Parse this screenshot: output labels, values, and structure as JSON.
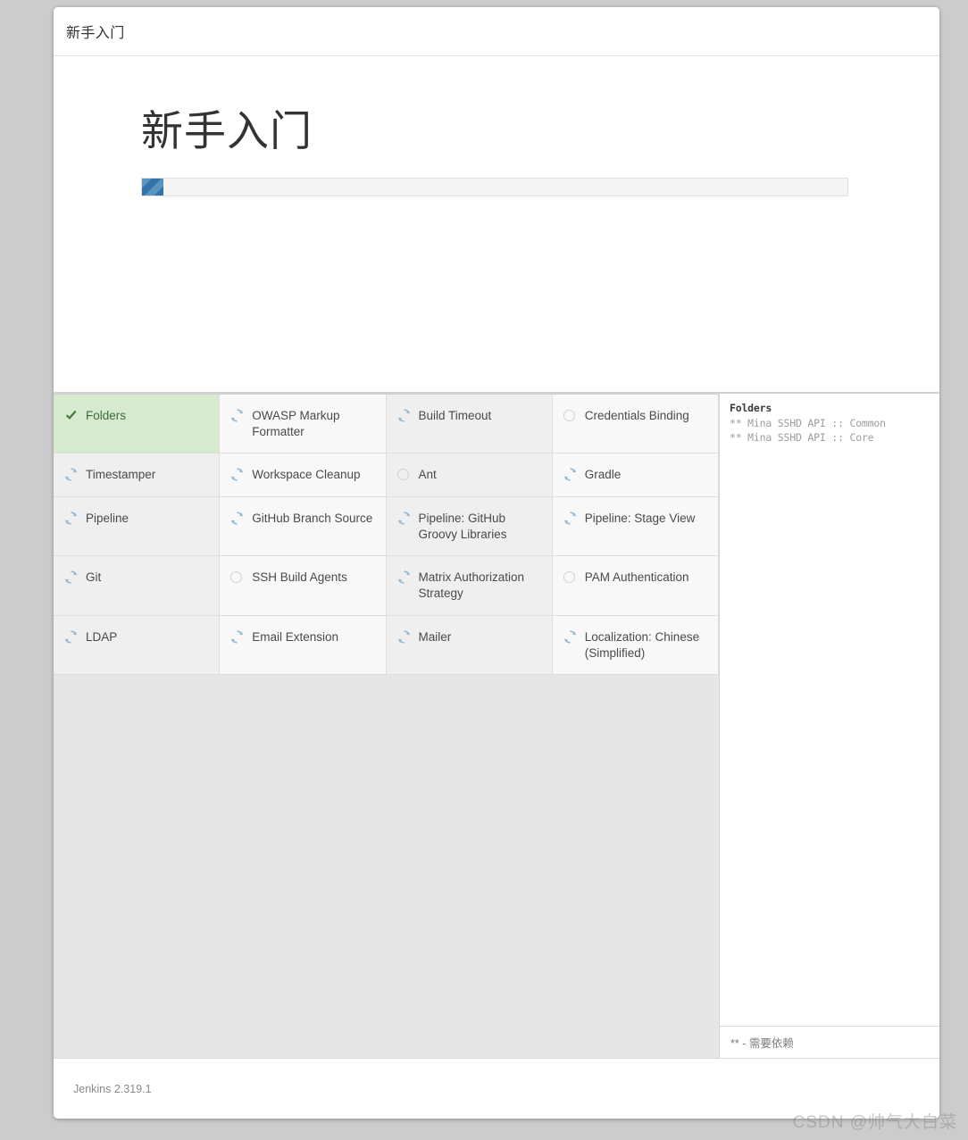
{
  "window": {
    "title": "新手入门"
  },
  "setup": {
    "heading": "新手入门",
    "progress_percent": 3,
    "progress_icon": "progress-bar"
  },
  "plugins": {
    "columns": 4,
    "items": [
      {
        "name": "Folders",
        "status": "done",
        "icon": "check-icon"
      },
      {
        "name": "OWASP Markup Formatter",
        "status": "installing",
        "icon": "spinner-icon"
      },
      {
        "name": "Build Timeout",
        "status": "installing",
        "icon": "spinner-icon"
      },
      {
        "name": "Credentials Binding",
        "status": "pending",
        "icon": "pending-circle-icon"
      },
      {
        "name": "Timestamper",
        "status": "installing",
        "icon": "spinner-icon"
      },
      {
        "name": "Workspace Cleanup",
        "status": "installing",
        "icon": "spinner-icon"
      },
      {
        "name": "Ant",
        "status": "pending",
        "icon": "pending-circle-icon"
      },
      {
        "name": "Gradle",
        "status": "installing",
        "icon": "spinner-icon"
      },
      {
        "name": "Pipeline",
        "status": "installing",
        "icon": "spinner-icon"
      },
      {
        "name": "GitHub Branch Source",
        "status": "installing",
        "icon": "spinner-icon"
      },
      {
        "name": "Pipeline: GitHub Groovy Libraries",
        "status": "installing",
        "icon": "spinner-icon"
      },
      {
        "name": "Pipeline: Stage View",
        "status": "installing",
        "icon": "spinner-icon"
      },
      {
        "name": "Git",
        "status": "installing",
        "icon": "spinner-icon"
      },
      {
        "name": "SSH Build Agents",
        "status": "pending",
        "icon": "pending-circle-icon"
      },
      {
        "name": "Matrix Authorization Strategy",
        "status": "installing",
        "icon": "spinner-icon"
      },
      {
        "name": "PAM Authentication",
        "status": "pending",
        "icon": "pending-circle-icon"
      },
      {
        "name": "LDAP",
        "status": "installing",
        "icon": "spinner-icon"
      },
      {
        "name": "Email Extension",
        "status": "installing",
        "icon": "spinner-icon"
      },
      {
        "name": "Mailer",
        "status": "installing",
        "icon": "spinner-icon"
      },
      {
        "name": "Localization: Chinese (Simplified)",
        "status": "installing",
        "icon": "spinner-icon"
      }
    ]
  },
  "log": {
    "current_plugin": "Folders",
    "lines": [
      "** Mina SSHD API :: Common",
      "** Mina SSHD API :: Core"
    ],
    "legend": "** - 需要依赖"
  },
  "footer": {
    "version": "Jenkins 2.319.1"
  },
  "watermark": {
    "text": "CSDN @帅气大白菜"
  },
  "colors": {
    "accent_blue": "#2f74ad",
    "done_green_bg": "#d6ead0",
    "done_green_fg": "#3c6b37",
    "spinner_blue": "#8fb8d4",
    "page_bg": "#cccccc"
  }
}
